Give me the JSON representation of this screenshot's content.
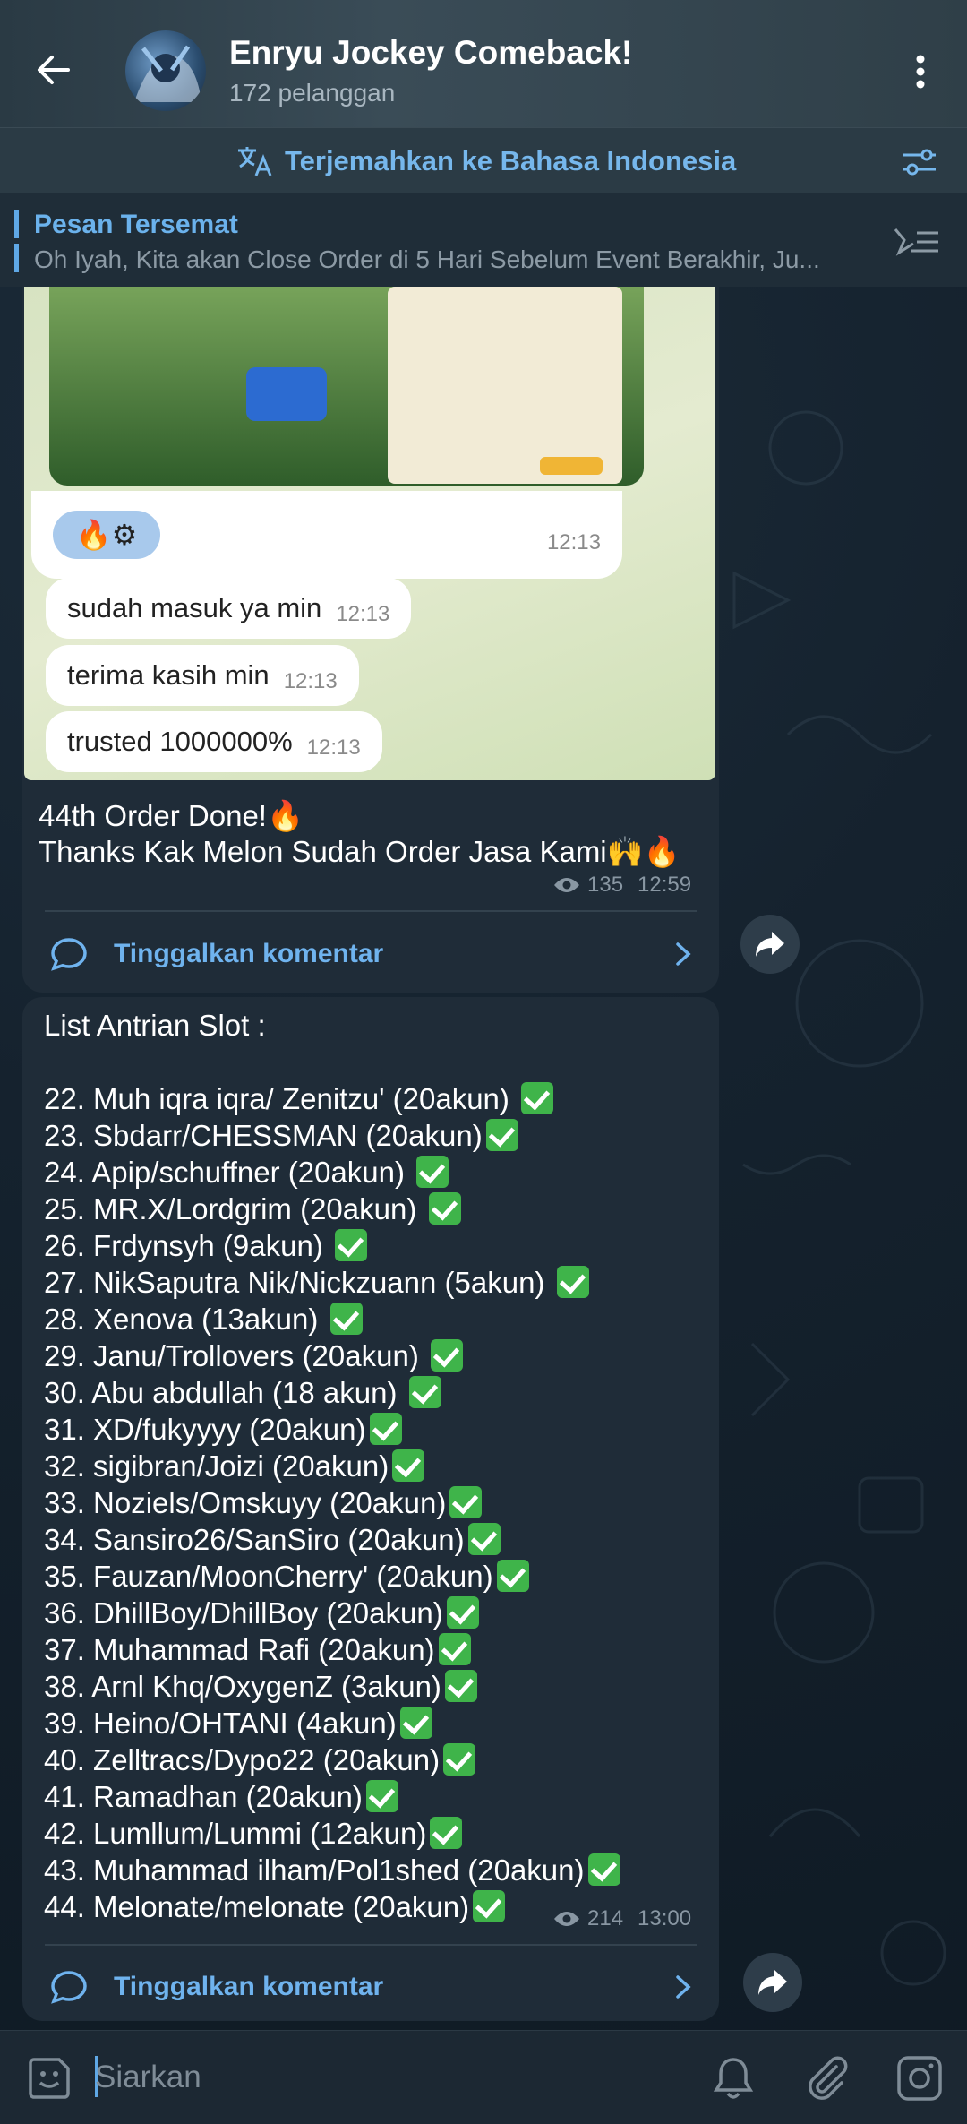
{
  "header": {
    "title": "Enryu Jockey Comeback!",
    "subtitle": "172 pelanggan"
  },
  "translate": {
    "label": "Terjemahkan ke Bahasa Indonesia"
  },
  "pinned": {
    "title": "Pesan Tersemat",
    "text": "Oh Iyah, Kita akan Close Order di 5 Hari Sebelum Event Berakhir, Ju..."
  },
  "photo_chat": {
    "time_top": "12:13",
    "messages": [
      {
        "text": "sudah masuk ya min",
        "time": "12:13"
      },
      {
        "text": "terima kasih min",
        "time": "12:13"
      },
      {
        "text": "trusted 1000000%",
        "time": "12:13"
      }
    ]
  },
  "post1": {
    "line1": "44th Order Done!🔥",
    "line2": "Thanks Kak Melon Sudah Order Jasa Kami🙌🔥",
    "views": "135",
    "time": "12:59",
    "comment_label": "Tinggalkan komentar"
  },
  "post2": {
    "heading": "List Antrian Slot :",
    "items": [
      "22. Muh iqra iqra/ Zenitzu' (20akun) ",
      "23. Sbdarr/CHESSMAN (20akun)",
      "24. Apip/schuffner (20akun) ",
      "25. MR.X/Lordgrim (20akun) ",
      "26. Frdynsyh (9akun) ",
      "27. NikSaputra Nik/Nickzuann (5akun) ",
      "28. Xenova (13akun) ",
      "29. Janu/Trollovers (20akun) ",
      "30. Abu abdullah (18 akun) ",
      "31. XD/fukyyyy (20akun)",
      "32. sigibran/Joizi (20akun)",
      "33. Noziels/Omskuyy (20akun)",
      "34. Sansiro26/SanSiro (20akun)",
      "35. Fauzan/MoonCherry' (20akun)",
      "36. DhillBoy/DhillBoy (20akun)",
      "37. Muhammad Rafi (20akun)",
      "38. Arnl Khq/OxygenZ (3akun)",
      "39. Heino/OHTANI (4akun)",
      "40. Zelltracs/Dypo22 (20akun)",
      "41. Ramadhan (20akun)",
      "42. Lumllum/Lummi (12akun)",
      "43. Muhammad ilham/Pol1shed (20akun)",
      "44. Melonate/melonate (20akun)"
    ],
    "views": "214",
    "time": "13:00",
    "comment_label": "Tinggalkan komentar"
  },
  "input": {
    "placeholder": "Siarkan"
  },
  "icons": [
    "back-arrow-icon",
    "more-vert-icon",
    "translate-icon",
    "filter-icon",
    "pinned-list-icon",
    "eye-icon",
    "comment-icon",
    "chevron-right-icon",
    "share-icon",
    "emoji-icon",
    "bell-icon",
    "attach-icon",
    "camera-icon"
  ],
  "colors": {
    "accent": "#6fb3ee",
    "check": "#3fb44a",
    "bubble": "#1f2c38"
  }
}
